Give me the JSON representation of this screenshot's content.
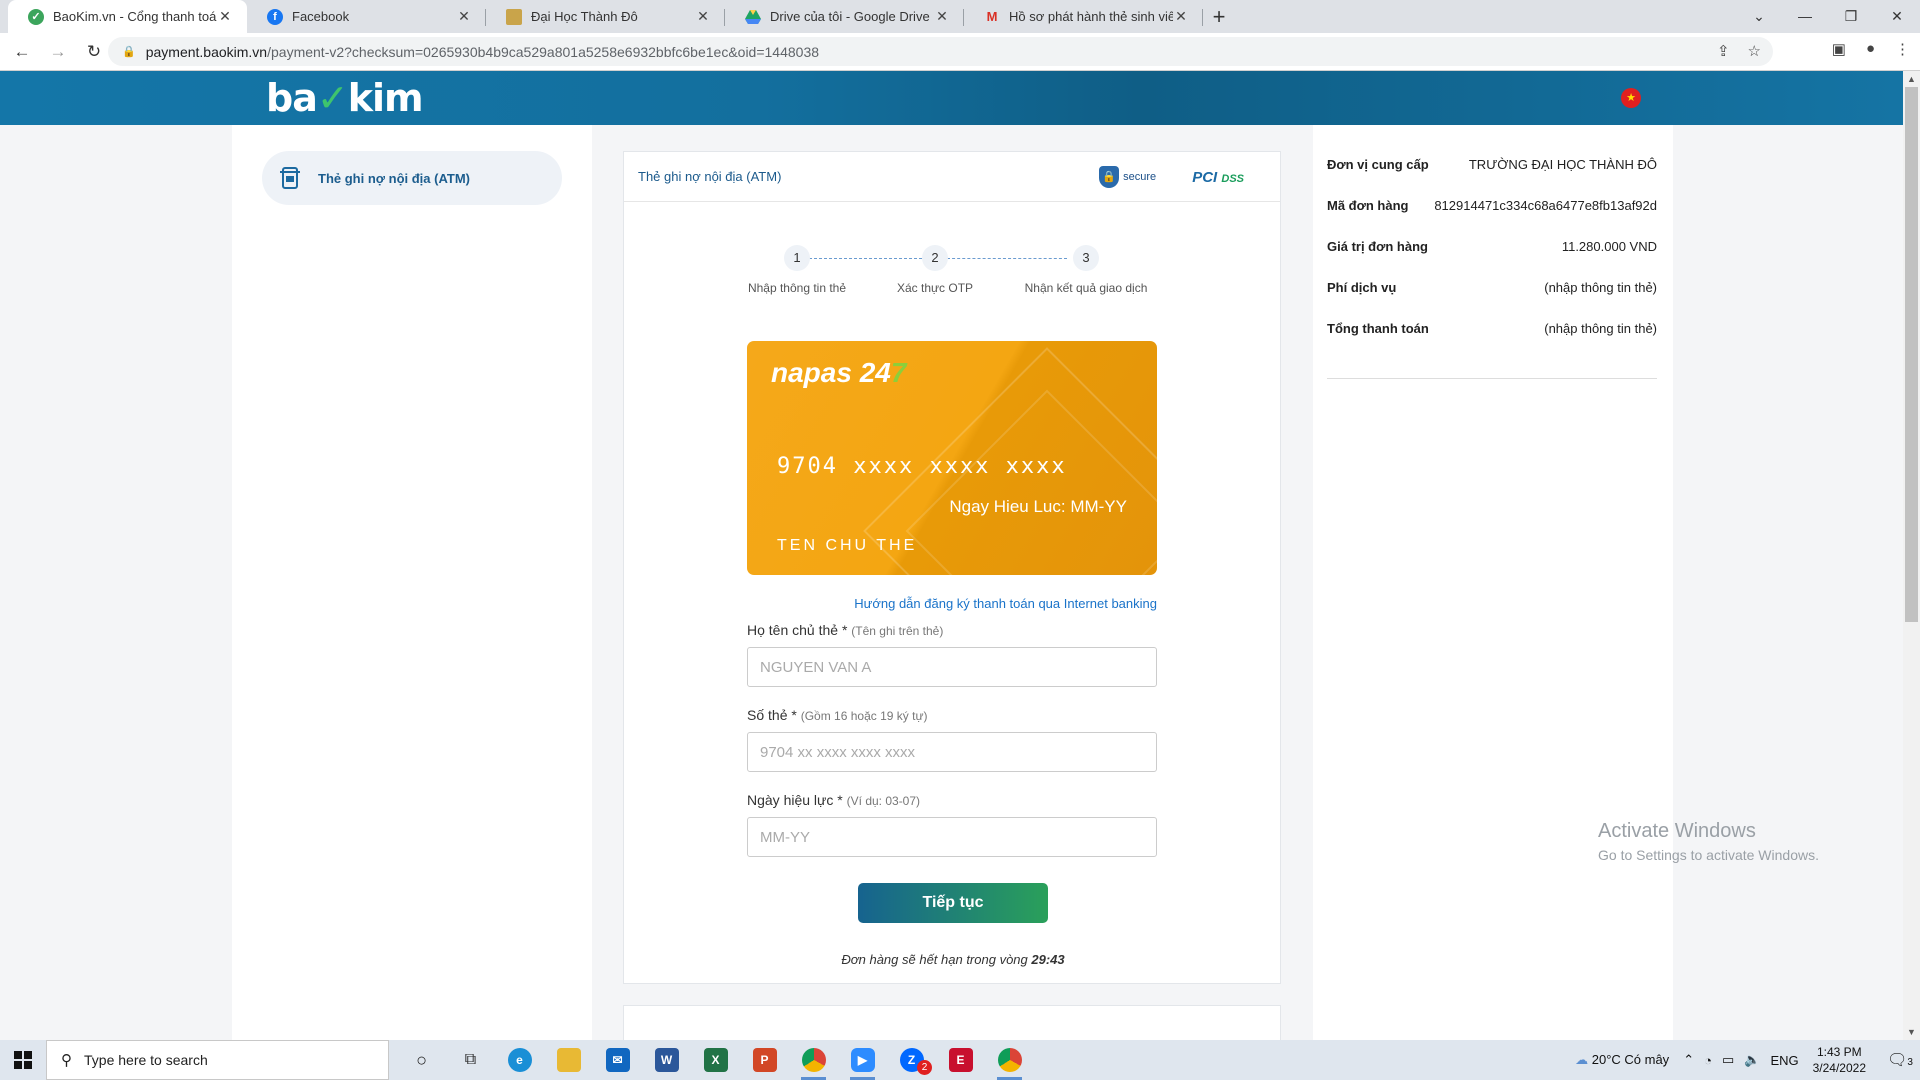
{
  "browser": {
    "tabs": [
      {
        "title": "BaoKim.vn - Cổng thanh toán trự",
        "icon": "baokim-check-icon",
        "color": "#3ca55c"
      },
      {
        "title": "Facebook",
        "icon": "facebook-icon",
        "color": "#1877f2"
      },
      {
        "title": "Đại Học Thành Đô",
        "icon": "school-icon",
        "color": "#c9a44a"
      },
      {
        "title": "Drive của tôi - Google Drive",
        "icon": "google-drive-icon",
        "color": "#1fa463"
      },
      {
        "title": "Hồ sơ phát hành thẻ sinh viên liê",
        "icon": "gmail-icon",
        "color": "#d93025"
      }
    ],
    "url_domain": "payment.baokim.vn",
    "url_path": "/payment-v2?checksum=0265930b4b9ca529a801a5258e6932bbfc6be1ec&oid=1448038"
  },
  "header": {
    "logo_a": "ba",
    "logo_b": "kim"
  },
  "left": {
    "method_label": "Thẻ ghi nợ nội địa (ATM)"
  },
  "card": {
    "title": "Thẻ ghi nợ nội địa (ATM)",
    "badge_secure": "secure",
    "badge_pci": "PCI",
    "badge_dss": "DSS",
    "steps": [
      {
        "num": "1",
        "label": "Nhập thông tin thẻ"
      },
      {
        "num": "2",
        "label": "Xác thực OTP"
      },
      {
        "num": "3",
        "label": "Nhận kết quả giao dịch"
      }
    ],
    "bank_card": {
      "brand": "napas 24",
      "brand_7": "7",
      "number": "9704 xxxx xxxx xxxx",
      "expiry": "Ngay Hieu Luc: MM-YY",
      "holder": "TEN CHU THE"
    },
    "ibanking_link": "Hướng dẫn đăng ký thanh toán qua Internet banking",
    "fields": [
      {
        "label": "Họ tên chủ thẻ *",
        "hint": "(Tên ghi trên thẻ)",
        "placeholder": "NGUYEN VAN A"
      },
      {
        "label": "Số thẻ *",
        "hint": "(Gồm 16 hoặc 19 ký tự)",
        "placeholder": "9704 xx xxxx xxxx xxxx"
      },
      {
        "label": "Ngày hiệu lực *",
        "hint": "(Ví dụ: 03-07)",
        "placeholder": "MM-YY"
      }
    ],
    "submit_label": "Tiếp tục",
    "expire_text": "Đơn hàng sẽ hết hạn trong vòng ",
    "expire_time": "29:43"
  },
  "summary": [
    {
      "key": "Đơn vị cung cấp",
      "value": "TRƯỜNG ĐẠI HỌC THÀNH ĐÔ"
    },
    {
      "key": "Mã đơn hàng",
      "value": "812914471c334c68a6477e8fb13af92d"
    },
    {
      "key": "Giá trị đơn hàng",
      "value": "11.280.000 VND"
    },
    {
      "key": "Phí dịch vụ",
      "value": "(nhập thông tin thẻ)"
    },
    {
      "key": "Tổng thanh toán",
      "value": "(nhập thông tin thẻ)"
    }
  ],
  "watermark": {
    "line1": "Activate Windows",
    "line2": "Go to Settings to activate Windows."
  },
  "taskbar": {
    "search_placeholder": "Type here to search",
    "weather": "20°C  Có mây",
    "lang": "ENG",
    "time": "1:43 PM",
    "date": "3/24/2022",
    "notif_count": "3",
    "zalo_badge": "2"
  }
}
